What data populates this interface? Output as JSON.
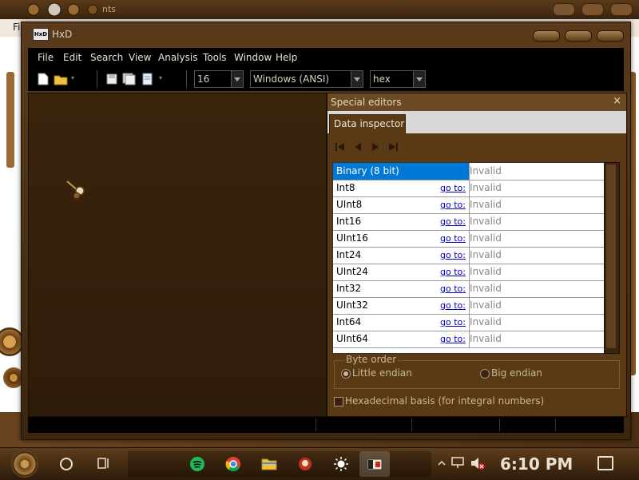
{
  "background_app": {
    "title": "nts",
    "menu_first": "Fi"
  },
  "window": {
    "icon_text": "HxD",
    "title": "HxD"
  },
  "menu": {
    "items": [
      "File",
      "Edit",
      "Search",
      "View",
      "Analysis",
      "Tools",
      "Window",
      "Help"
    ]
  },
  "toolbar": {
    "bytes_per_row": "16",
    "charset": "Windows (ANSI)",
    "offset_base": "hex"
  },
  "special_editors": {
    "title": "Special editors",
    "close": "×",
    "tab": "Data inspector",
    "rows": [
      {
        "name": "Binary (8 bit)",
        "goto": "",
        "value": "Invalid",
        "selected": true
      },
      {
        "name": "Int8",
        "goto": "go to:",
        "value": "Invalid"
      },
      {
        "name": "UInt8",
        "goto": "go to:",
        "value": "Invalid"
      },
      {
        "name": "Int16",
        "goto": "go to:",
        "value": "Invalid"
      },
      {
        "name": "UInt16",
        "goto": "go to:",
        "value": "Invalid"
      },
      {
        "name": "Int24",
        "goto": "go to:",
        "value": "Invalid"
      },
      {
        "name": "UInt24",
        "goto": "go to:",
        "value": "Invalid"
      },
      {
        "name": "Int32",
        "goto": "go to:",
        "value": "Invalid"
      },
      {
        "name": "UInt32",
        "goto": "go to:",
        "value": "Invalid"
      },
      {
        "name": "Int64",
        "goto": "go to:",
        "value": "Invalid"
      },
      {
        "name": "UInt64",
        "goto": "go to:",
        "value": "Invalid"
      }
    ],
    "byte_order": {
      "legend": "Byte order",
      "little": "Little endian",
      "big": "Big endian",
      "selected": "little"
    },
    "hex_basis": "Hexadecimal basis (for integral numbers)"
  },
  "taskbar": {
    "clock": "6:10 PM",
    "apps": [
      "spotify-icon",
      "chrome-icon",
      "file-explorer-icon",
      "game-app-icon",
      "weather-app-icon",
      "hxd-icon"
    ]
  },
  "colors": {
    "selection": "#0078d7",
    "link": "#0000cc",
    "window_bg": "#5a3a14"
  }
}
